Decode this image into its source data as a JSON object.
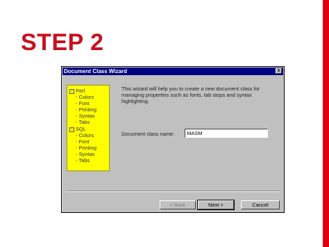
{
  "slide": {
    "title": "STEP 2"
  },
  "dialog": {
    "title": "Document Class Wizard",
    "close_label": "x",
    "tree": [
      {
        "label": "Perl",
        "level": 0,
        "expander": "−"
      },
      {
        "label": "Colors",
        "level": 1
      },
      {
        "label": "Font",
        "level": 1
      },
      {
        "label": "Printing",
        "level": 1
      },
      {
        "label": "Syntax",
        "level": 1
      },
      {
        "label": "Tabs",
        "level": 1
      },
      {
        "label": "SQL",
        "level": 0,
        "expander": "−"
      },
      {
        "label": "Colors",
        "level": 1
      },
      {
        "label": "Font",
        "level": 1
      },
      {
        "label": "Printing",
        "level": 1
      },
      {
        "label": "Syntax",
        "level": 1
      },
      {
        "label": "Tabs",
        "level": 1
      }
    ],
    "description_lines": [
      "This wizard will help you to create a new document class for",
      "managing properties such as fonts, tab stops and syntax",
      "highlighting."
    ],
    "class_name_label": "Document class name:",
    "class_name_value": "MASM",
    "buttons": {
      "back": "< Back",
      "next": "Next >",
      "cancel": "Cancel"
    }
  },
  "colors": {
    "accent": "#c8101e",
    "title_bar": "#000080",
    "highlight": "#ffff00"
  }
}
